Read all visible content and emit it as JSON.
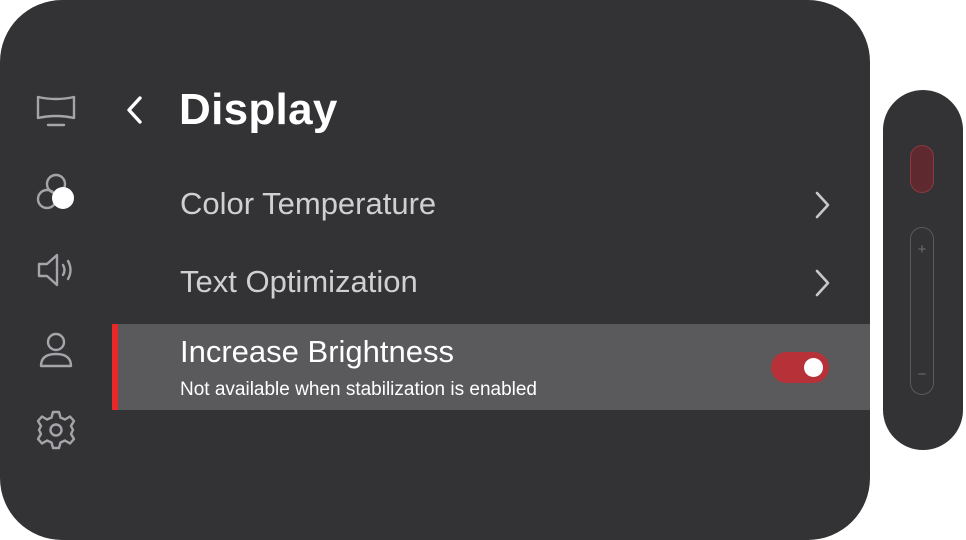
{
  "header": {
    "title": "Display",
    "back_icon": "chevron-left-icon"
  },
  "sidebar": {
    "items": [
      {
        "icon": "tv-display-icon",
        "label": "Display"
      },
      {
        "icon": "color-circles-icon",
        "label": "Color",
        "active": true
      },
      {
        "icon": "speaker-volume-icon",
        "label": "Sound"
      },
      {
        "icon": "user-profile-icon",
        "label": "Profile"
      },
      {
        "icon": "gear-icon",
        "label": "Settings"
      }
    ]
  },
  "menu": {
    "items": [
      {
        "label": "Color Temperature",
        "icon": "chevron-right-icon"
      },
      {
        "label": "Text Optimization",
        "icon": "chevron-right-icon"
      },
      {
        "label": "Increase Brightness",
        "subtitle": "Not available when stabilization is enabled",
        "toggle": true,
        "selected": true
      }
    ]
  },
  "remote": {
    "volume_up": "+",
    "volume_down": "−"
  },
  "colors": {
    "panel": "#333234",
    "selected_row": "#5a595c",
    "accent": "#e62828",
    "toggle_on": "#b63238",
    "text_primary": "#ffffff",
    "text_secondary": "#d0cfd2"
  }
}
